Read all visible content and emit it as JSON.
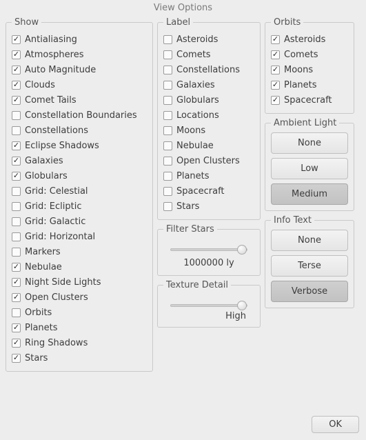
{
  "title": "View Options",
  "groups": {
    "show": "Show",
    "label": "Label",
    "orbits": "Orbits",
    "ambient": "Ambient Light",
    "info": "Info Text",
    "filter": "Filter Stars",
    "texture": "Texture Detail"
  },
  "show_items": [
    {
      "label": "Antialiasing",
      "checked": true
    },
    {
      "label": "Atmospheres",
      "checked": true
    },
    {
      "label": "Auto Magnitude",
      "checked": true
    },
    {
      "label": "Clouds",
      "checked": true
    },
    {
      "label": "Comet Tails",
      "checked": true
    },
    {
      "label": "Constellation Boundaries",
      "checked": false
    },
    {
      "label": "Constellations",
      "checked": false
    },
    {
      "label": "Eclipse Shadows",
      "checked": true
    },
    {
      "label": "Galaxies",
      "checked": true
    },
    {
      "label": "Globulars",
      "checked": true
    },
    {
      "label": "Grid: Celestial",
      "checked": false
    },
    {
      "label": "Grid: Ecliptic",
      "checked": false
    },
    {
      "label": "Grid: Galactic",
      "checked": false
    },
    {
      "label": "Grid: Horizontal",
      "checked": false
    },
    {
      "label": "Markers",
      "checked": false
    },
    {
      "label": "Nebulae",
      "checked": true
    },
    {
      "label": "Night Side Lights",
      "checked": true
    },
    {
      "label": "Open Clusters",
      "checked": true
    },
    {
      "label": "Orbits",
      "checked": false
    },
    {
      "label": "Planets",
      "checked": true
    },
    {
      "label": "Ring Shadows",
      "checked": true
    },
    {
      "label": "Stars",
      "checked": true
    }
  ],
  "label_items": [
    {
      "label": "Asteroids",
      "checked": false
    },
    {
      "label": "Comets",
      "checked": false
    },
    {
      "label": "Constellations",
      "checked": false
    },
    {
      "label": "Galaxies",
      "checked": false
    },
    {
      "label": "Globulars",
      "checked": false
    },
    {
      "label": "Locations",
      "checked": false
    },
    {
      "label": "Moons",
      "checked": false
    },
    {
      "label": "Nebulae",
      "checked": false
    },
    {
      "label": "Open Clusters",
      "checked": false
    },
    {
      "label": "Planets",
      "checked": false
    },
    {
      "label": "Spacecraft",
      "checked": false
    },
    {
      "label": "Stars",
      "checked": false
    }
  ],
  "orbit_items": [
    {
      "label": "Asteroids",
      "checked": true
    },
    {
      "label": "Comets",
      "checked": true
    },
    {
      "label": "Moons",
      "checked": true
    },
    {
      "label": "Planets",
      "checked": true
    },
    {
      "label": "Spacecraft",
      "checked": true
    }
  ],
  "ambient_buttons": [
    {
      "label": "None",
      "active": false
    },
    {
      "label": "Low",
      "active": false
    },
    {
      "label": "Medium",
      "active": true
    }
  ],
  "info_buttons": [
    {
      "label": "None",
      "active": false
    },
    {
      "label": "Terse",
      "active": false
    },
    {
      "label": "Verbose",
      "active": true
    }
  ],
  "filter": {
    "value_label": "1000000 ly",
    "position_pct": 94
  },
  "texture": {
    "value_label": "High",
    "position_pct": 94
  },
  "ok_label": "OK",
  "chart_data": null
}
